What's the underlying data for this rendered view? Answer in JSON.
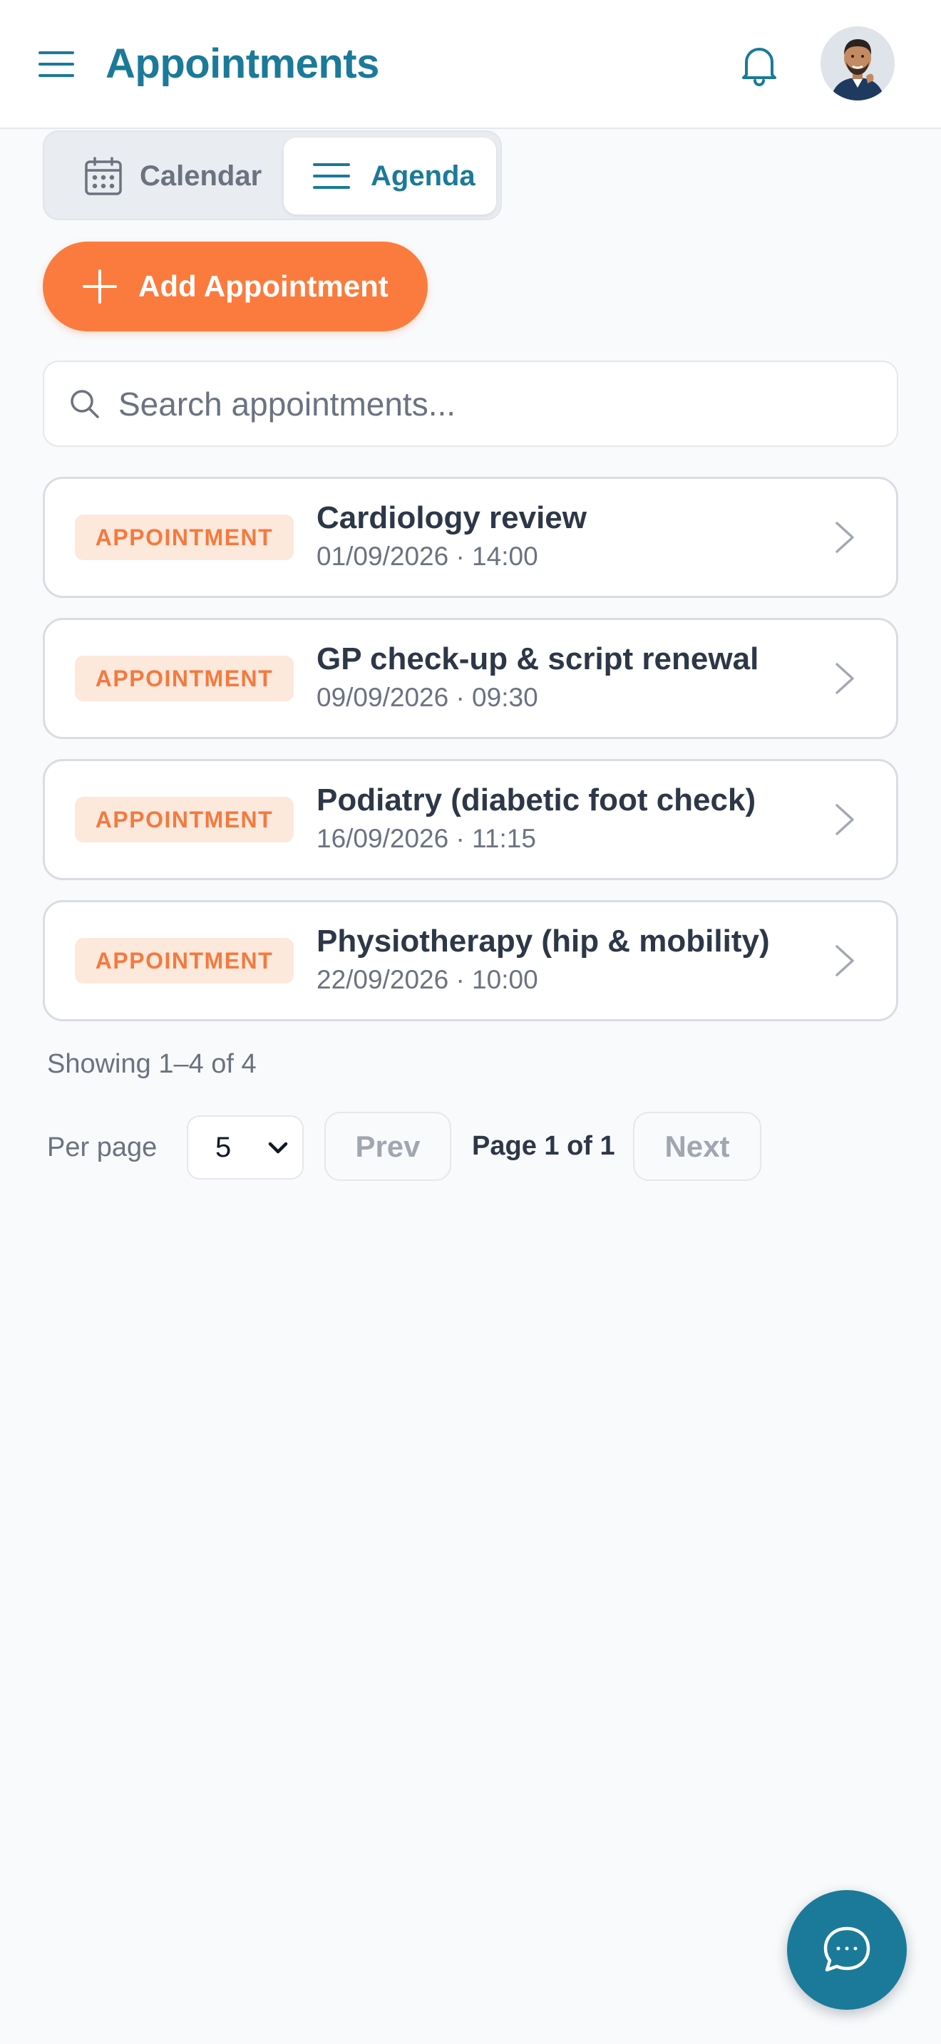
{
  "header": {
    "title": "Appointments",
    "menu_icon": "hamburger-menu-icon",
    "bell_icon": "bell-icon",
    "avatar_icon": "user-avatar"
  },
  "view_toggle": {
    "calendar_label": "Calendar",
    "agenda_label": "Agenda",
    "selected": "Agenda"
  },
  "add_button": {
    "label": "Add Appointment"
  },
  "search": {
    "placeholder": "Search appointments...",
    "value": ""
  },
  "appointments": [
    {
      "badge": "APPOINTMENT",
      "title": "Cardiology review",
      "datetime": "01/09/2026 · 14:00"
    },
    {
      "badge": "APPOINTMENT",
      "title": "GP check-up & script renewal",
      "datetime": "09/09/2026 · 09:30"
    },
    {
      "badge": "APPOINTMENT",
      "title": "Podiatry (diabetic foot check)",
      "datetime": "16/09/2026 · 11:15"
    },
    {
      "badge": "APPOINTMENT",
      "title": "Physiotherapy (hip & mobility)",
      "datetime": "22/09/2026 · 10:00"
    }
  ],
  "pagination": {
    "showing": "Showing 1–4 of 4",
    "per_page_label": "Per page",
    "per_page_value": "5",
    "prev_label": "Prev",
    "page_info": "Page 1 of 1",
    "next_label": "Next"
  },
  "colors": {
    "primary": "#1b7a99",
    "accent": "#fb7b3e",
    "badge_bg": "#fde8dc",
    "background": "#f8fafc"
  },
  "chat_fab": {
    "icon": "chat-bubble-icon"
  }
}
